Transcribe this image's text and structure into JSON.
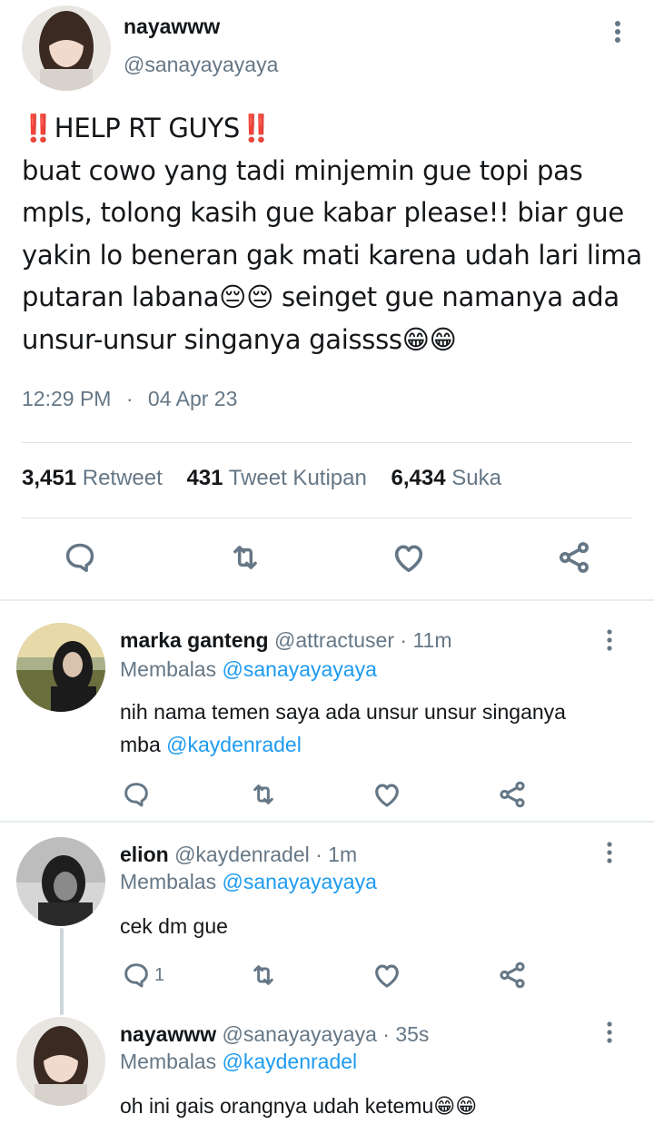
{
  "main_tweet": {
    "name": "nayawww",
    "handle": "@sanayayayaya",
    "text_lines": [
      "‼️HELP RT GUYS‼️",
      "buat cowo yang tadi minjemin gue topi pas",
      "mpls, tolong kasih gue kabar please!! biar gue",
      "yakin lo beneran gak mati karena udah lari lima",
      "putaran labana😔😔 seinget gue namanya ada",
      "unsur-unsur singanya gaissss😁😁"
    ],
    "time": "12:29 PM",
    "dot": "·",
    "date": "04 Apr 23",
    "stats": {
      "retweets": "3,451",
      "retweets_label": "Retweet",
      "quotes": "431",
      "quotes_label": "Tweet Kutipan",
      "likes": "6,434",
      "likes_label": "Suka"
    }
  },
  "replies": [
    {
      "name": "marka ganteng",
      "handle": "@attractuser",
      "age": "· 11m",
      "replying_label": "Membalas",
      "replying_to": "@sanayayayaya",
      "text": "nih nama temen saya ada unsur unsur singanya",
      "text2_prefix": "mba ",
      "mention": "@kaydenradel",
      "reply_count": ""
    },
    {
      "name": "elion",
      "handle": "@kaydenradel",
      "age": "· 1m",
      "replying_label": "Membalas",
      "replying_to": "@sanayayayaya",
      "text": "cek dm gue",
      "reply_count": "1"
    },
    {
      "name": "nayawww",
      "handle": "@sanayayayaya",
      "age": "· 35s",
      "replying_label": "Membalas",
      "replying_to": "@kaydenradel",
      "text": "oh ini gais orangnya udah ketemu😁😁"
    }
  ],
  "icons": {
    "reply": "reply-icon",
    "retweet": "retweet-icon",
    "like": "heart-icon",
    "share": "share-icon",
    "more": "more-vertical-icon"
  },
  "colors": {
    "accent": "#1d9bf0",
    "secondary": "#657786",
    "text": "#14171a",
    "divider": "#e6ecf0"
  }
}
